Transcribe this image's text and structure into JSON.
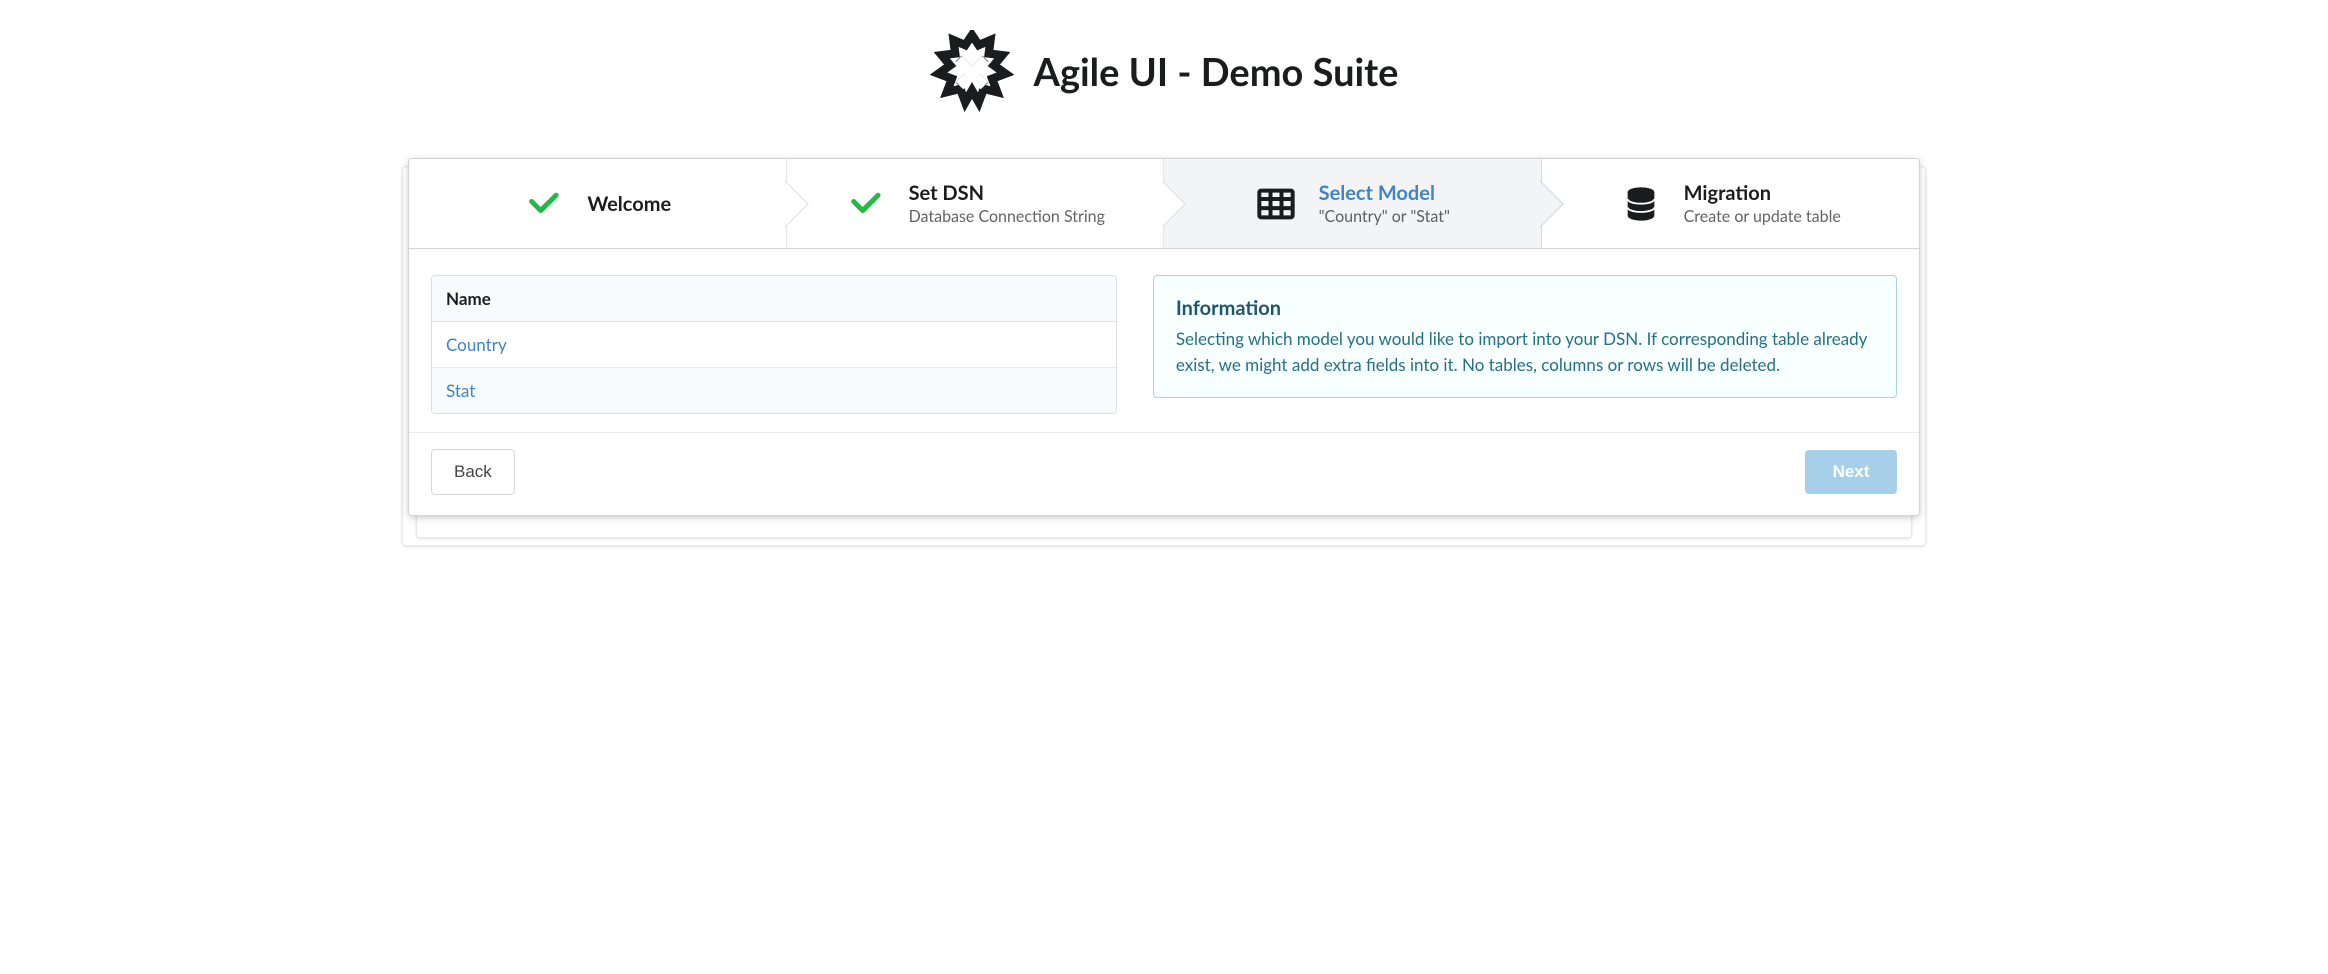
{
  "header": {
    "title": "Agile UI - Demo Suite"
  },
  "steps": [
    {
      "title": "Welcome",
      "desc": "",
      "icon": "check-icon",
      "state": "completed"
    },
    {
      "title": "Set DSN",
      "desc": "Database Connection String",
      "icon": "check-icon",
      "state": "completed"
    },
    {
      "title": "Select Model",
      "desc": "\"Country\" or \"Stat\"",
      "icon": "table-icon",
      "state": "active"
    },
    {
      "title": "Migration",
      "desc": "Create or update table",
      "icon": "database-icon",
      "state": "default"
    }
  ],
  "table": {
    "header": "Name",
    "rows": [
      "Country",
      "Stat"
    ]
  },
  "info": {
    "title": "Information",
    "body": "Selecting which model you would like to import into your DSN. If corresponding table already exist, we might add extra fields into it. No tables, columns or rows will be deleted."
  },
  "footer": {
    "back": "Back",
    "next": "Next"
  }
}
